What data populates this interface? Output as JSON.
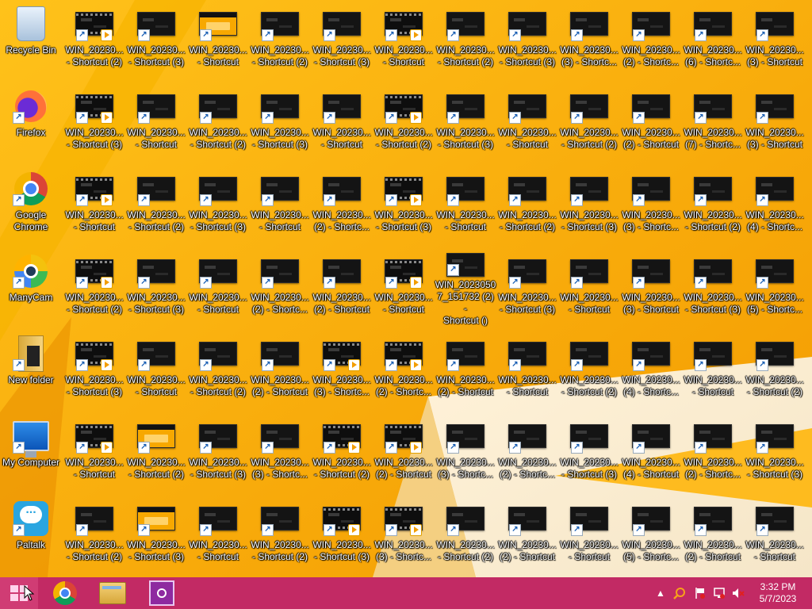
{
  "desktop": {
    "system_icons": [
      {
        "label": "Recycle Bin",
        "icon": "recycle-bin-icon"
      },
      {
        "label": "Firefox",
        "icon": "firefox-icon"
      },
      {
        "label": "Google Chrome",
        "icon": "chrome-icon"
      },
      {
        "label": "ManyCam",
        "icon": "manycam-icon"
      },
      {
        "label": "New folder",
        "icon": "folder-icon"
      },
      {
        "label": "My Computer",
        "icon": "computer-icon"
      },
      {
        "label": "Paltalk",
        "icon": "paltalk-icon"
      }
    ],
    "shortcut_columns": [
      [
        "WIN_20230...\n- Shortcut (2)",
        "WIN_20230...\n- Shortcut (3)",
        "WIN_20230...\n- Shortcut",
        "WIN_20230...\n- Shortcut (2)",
        "WIN_20230...\n- Shortcut (3)",
        "WIN_20230...\n- Shortcut",
        "WIN_20230...\n- Shortcut (2)"
      ],
      [
        "WIN_20230...\n- Shortcut (3)",
        "WIN_20230...\n- Shortcut",
        "WIN_20230...\n- Shortcut (2)",
        "WIN_20230...\n- Shortcut (3)",
        "WIN_20230...\n- Shortcut",
        "WIN_20230...\n- Shortcut (2)",
        "WIN_20230...\n- Shortcut (3)"
      ],
      [
        "WIN_20230...\n- Shortcut",
        "WIN_20230...\n- Shortcut (2)",
        "WIN_20230...\n- Shortcut (3)",
        "WIN_20230...\n- Shortcut",
        "WIN_20230...\n- Shortcut (2)",
        "WIN_20230...\n- Shortcut (3)",
        "WIN_20230...\n- Shortcut"
      ],
      [
        "WIN_20230...\n- Shortcut (2)",
        "WIN_20230...\n- Shortcut (3)",
        "WIN_20230...\n- Shortcut",
        "WIN_20230...\n(2) - Shortc...",
        "WIN_20230...\n(2) - Shortcut",
        "WIN_20230...\n(3) - Shortc...",
        "WIN_20230...\n- Shortcut (2)"
      ],
      [
        "WIN_20230...\n- Shortcut (3)",
        "WIN_20230...\n- Shortcut",
        "WIN_20230...\n(2) - Shortc...",
        "WIN_20230...\n(2) - Shortcut",
        "WIN_20230...\n(3) - Shortc...",
        "WIN_20230...\n- Shortcut (2)",
        "WIN_20230...\n- Shortcut (3)"
      ],
      [
        "WIN_20230...\n- Shortcut",
        "WIN_20230...\n- Shortcut (2)",
        "WIN_20230...\n- Shortcut (3)",
        "WIN_20230...\n- Shortcut",
        "WIN_20230...\n(2) - Shortc...",
        "WIN_20230...\n(2) - Shortcut",
        "WIN_20230...\n(3) - Shortc..."
      ],
      [
        "WIN_20230...\n- Shortcut (2)",
        "WIN_20230...\n- Shortcut (3)",
        "WIN_20230...\n- Shortcut",
        "WIN_2023050\n7_151732 (2) -\nShortcut ()",
        "WIN_20230...\n(2) - Shortcut",
        "WIN_20230...\n(3) - Shortc...",
        "WIN_20230...\n- Shortcut (2)"
      ],
      [
        "WIN_20230...\n- Shortcut (3)",
        "WIN_20230...\n- Shortcut",
        "WIN_20230...\n- Shortcut (2)",
        "WIN_20230...\n- Shortcut (3)",
        "WIN_20230...\n- Shortcut",
        "WIN_20230...\n(2) - Shortc...",
        "WIN_20230...\n(2) - Shortcut"
      ],
      [
        "WIN_20230...\n(3) - Shortc...",
        "WIN_20230...\n- Shortcut (2)",
        "WIN_20230...\n- Shortcut (3)",
        "WIN_20230...\n- Shortcut",
        "WIN_20230...\n- Shortcut (2)",
        "WIN_20230...\n- Shortcut (3)",
        "WIN_20230...\n- Shortcut"
      ],
      [
        "WIN_20230...\n(2) - Shortc...",
        "WIN_20230...\n(2) - Shortcut",
        "WIN_20230...\n(3) - Shortc...",
        "WIN_20230...\n(3) - Shortcut",
        "WIN_20230...\n(4) - Shortc...",
        "WIN_20230...\n(4) - Shortcut",
        "WIN_20230...\n(5) - Shortc..."
      ],
      [
        "WIN_20230...\n(6) - Shortc...",
        "WIN_20230...\n(7) - Shortc...",
        "WIN_20230...\n- Shortcut (2)",
        "WIN_20230...\n- Shortcut (3)",
        "WIN_20230...\n- Shortcut",
        "WIN_20230...\n(2) - Shortc...",
        "WIN_20230...\n(2) - Shortcut"
      ],
      [
        "WIN_20230...\n(3) - Shortcut",
        "WIN_20230...\n(3) - Shortcut",
        "WIN_20230...\n(4) - Shortc...",
        "WIN_20230...\n(5) - Shortc...",
        "WIN_20230...\n- Shortcut (2)",
        "WIN_20230...\n- Shortcut (3)",
        "WIN_20230...\n- Shortcut"
      ]
    ],
    "thumb_styles": [
      [
        "film",
        "dark",
        "orange",
        "dark",
        "dark",
        "film",
        "dark"
      ],
      [
        "film",
        "dark",
        "dark",
        "dark",
        "dark",
        "film",
        "dark"
      ],
      [
        "film",
        "dark",
        "dark",
        "dark",
        "dark",
        "film",
        "dark"
      ],
      [
        "film",
        "dark",
        "dark",
        "dark",
        "dark",
        "film",
        "dark"
      ],
      [
        "film",
        "dark",
        "dark",
        "dark",
        "film",
        "film",
        "dark"
      ],
      [
        "film",
        "orange",
        "dark",
        "dark",
        "film",
        "film",
        "dark"
      ],
      [
        "dark",
        "orange",
        "dark",
        "dark",
        "film",
        "film",
        "dark"
      ]
    ]
  },
  "taskbar": {
    "pinned": [
      {
        "name": "start-button",
        "icon": "windows-logo-icon"
      },
      {
        "name": "chrome-taskbar-button",
        "icon": "chrome-icon"
      },
      {
        "name": "file-explorer-taskbar-button",
        "icon": "file-explorer-icon"
      },
      {
        "name": "camera-app-taskbar-button",
        "icon": "camera-icon"
      }
    ],
    "tray_icons": [
      "show-hidden-icons-chevron",
      "search-icon",
      "action-center-flag-icon",
      "network-icon",
      "volume-muted-icon"
    ],
    "clock": {
      "time": "3:32 PM",
      "date": "5/7/2023"
    }
  },
  "colors": {
    "taskbar": "#c22a64",
    "start_highlight": "#d03c74",
    "wallpaper_primary": "#f5a800"
  }
}
